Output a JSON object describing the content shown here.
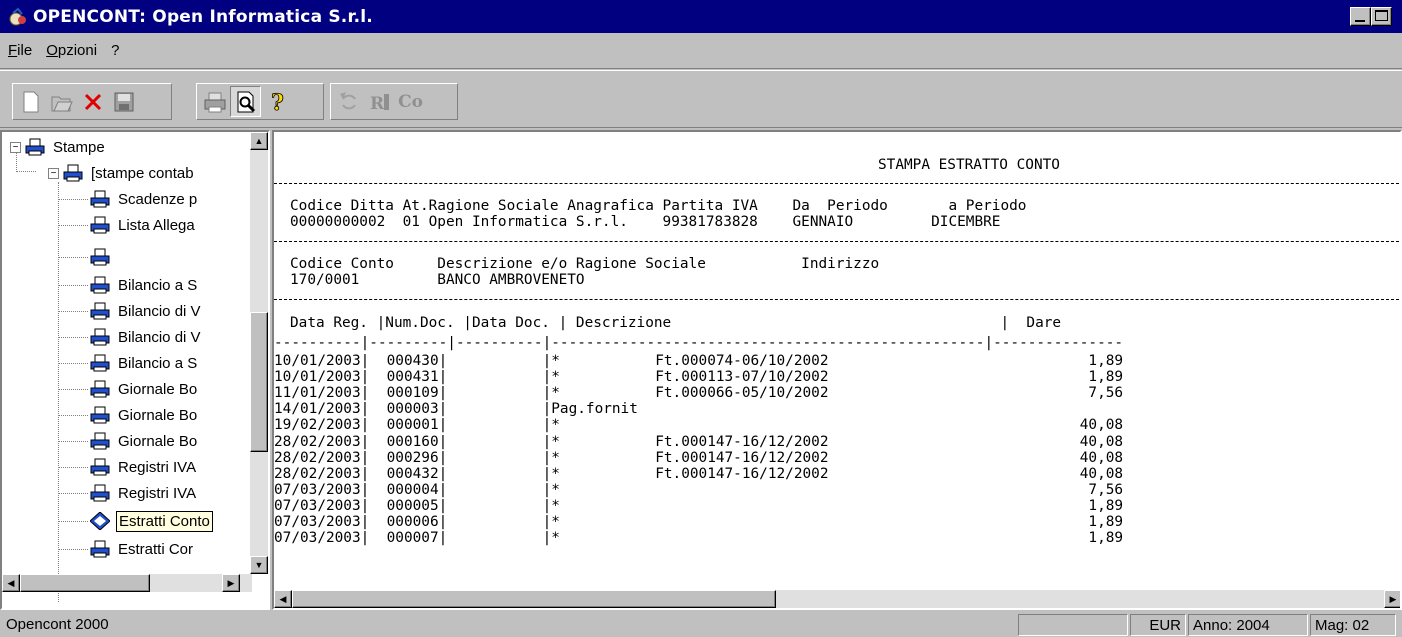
{
  "window": {
    "title": "OPENCONT: Open Informatica S.r.l."
  },
  "menu": [
    {
      "label": "File",
      "underline": "F",
      "rest": "ile"
    },
    {
      "label": "Opzioni",
      "underline": "O",
      "rest": "pzioni"
    },
    {
      "label": "?",
      "underline": "",
      "rest": "?"
    }
  ],
  "toolbar": {
    "groups": [
      [
        "new-icon",
        "open-icon",
        "delete-icon",
        "save-icon"
      ],
      [
        "print-icon",
        "print-preview-icon",
        "help-icon"
      ],
      [
        "refresh-icon",
        "report-icon",
        "co-icon"
      ]
    ],
    "co_label": "Co"
  },
  "tree": {
    "items": [
      {
        "label": "Stampe",
        "level": 0,
        "expander": "−"
      },
      {
        "label": "[stampe contab",
        "level": 1,
        "expander": "−"
      },
      {
        "label": "Scadenze p",
        "level": 2
      },
      {
        "label": "Lista Allega",
        "level": 2
      },
      {
        "label": "",
        "level": 2
      },
      {
        "label": "Bilancio a S",
        "level": 2
      },
      {
        "label": "Bilancio di V",
        "level": 2
      },
      {
        "label": "Bilancio di V",
        "level": 2
      },
      {
        "label": "Bilancio a S",
        "level": 2
      },
      {
        "label": "Giornale Bo",
        "level": 2
      },
      {
        "label": "Giornale Bo",
        "level": 2
      },
      {
        "label": "Giornale Bo",
        "level": 2
      },
      {
        "label": "Registri IVA",
        "level": 2
      },
      {
        "label": "Registri IVA",
        "level": 2
      },
      {
        "label": "Estratti Conto",
        "level": 2,
        "selected": true
      },
      {
        "label": "Estratti Cor",
        "level": 2
      }
    ]
  },
  "report": {
    "title": "STAMPA ESTRATTO CONTO",
    "header1": "Codice Ditta At.Ragione Sociale Anagrafica Partita IVA    Da  Periodo       a Periodo",
    "header1_values": "00000000002  01 Open Informatica S.r.l.    99381783828    GENNAIO         DICEMBRE",
    "header2": "Codice Conto     Descrizione e/o Ragione Sociale           Indirizzo",
    "header2_values": "170/0001         BANCO AMBROVENETO",
    "columns": "Data Reg. |Num.Doc. |Data Doc. | Descrizione                                      |  Dare",
    "columns_sep": "----------|---------|----------|--------------------------------------------------|---------------",
    "rows": [
      "10/01/2003|  000430|           |*           Ft.000074-06/10/2002                              1,89",
      "10/01/2003|  000431|           |*           Ft.000113-07/10/2002                              1,89",
      "11/01/2003|  000109|           |*           Ft.000066-05/10/2002                              7,56",
      "14/01/2003|  000003|           |Pag.fornit",
      "19/02/2003|  000001|           |*                                                            40,08",
      "28/02/2003|  000160|           |*           Ft.000147-16/12/2002                             40,08",
      "28/02/2003|  000296|           |*           Ft.000147-16/12/2002                             40,08",
      "28/02/2003|  000432|           |*           Ft.000147-16/12/2002                             40,08",
      "07/03/2003|  000004|           |*                                                             7,56",
      "07/03/2003|  000005|           |*                                                             1,89",
      "07/03/2003|  000006|           |*                                                             1,89",
      "07/03/2003|  000007|           |*                                                             1,89"
    ]
  },
  "status": {
    "app": "Opencont 2000",
    "currency": "EUR",
    "year": "Anno: 2004",
    "mag": "Mag: 02"
  }
}
